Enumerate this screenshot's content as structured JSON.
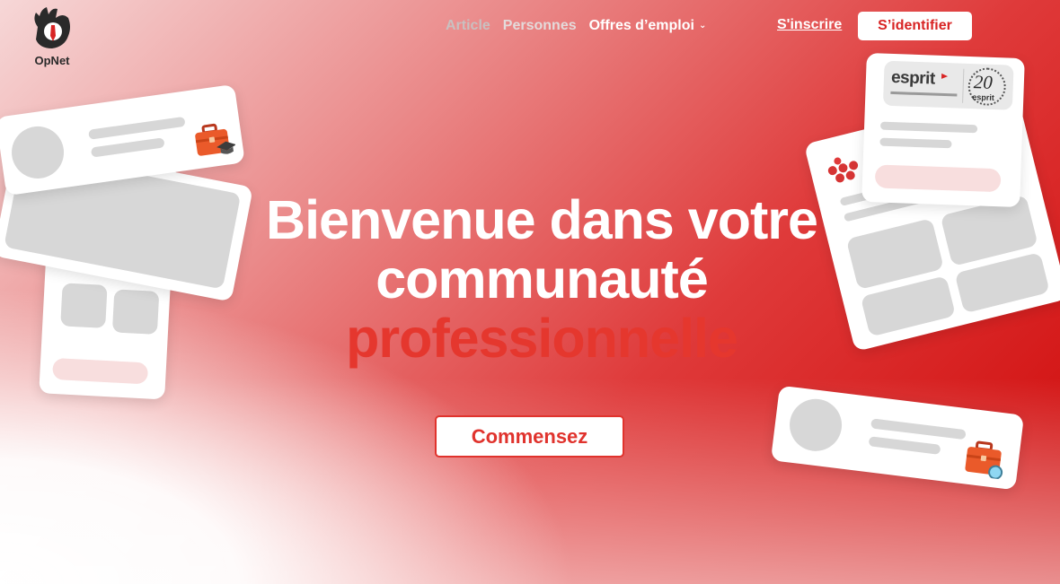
{
  "brand": {
    "name": "OpNet"
  },
  "nav": {
    "items": [
      {
        "label": "Article"
      },
      {
        "label": "Personnes"
      },
      {
        "label": "Offres d’emploi"
      }
    ],
    "signup_label": "S'inscrire",
    "login_label": "S’identifier"
  },
  "hero": {
    "line1": "Bienvenue dans votre",
    "line2": "communauté",
    "line3": "professionnelle",
    "cta_label": "Commensez"
  },
  "decor": {
    "partner_logo_text": "esprit",
    "partner_logo_badge_text": "20",
    "partner_logo_subtext": "esprit"
  },
  "colors": {
    "accent": "#e0332d",
    "brand_red": "#cf0808",
    "white": "#ffffff"
  }
}
